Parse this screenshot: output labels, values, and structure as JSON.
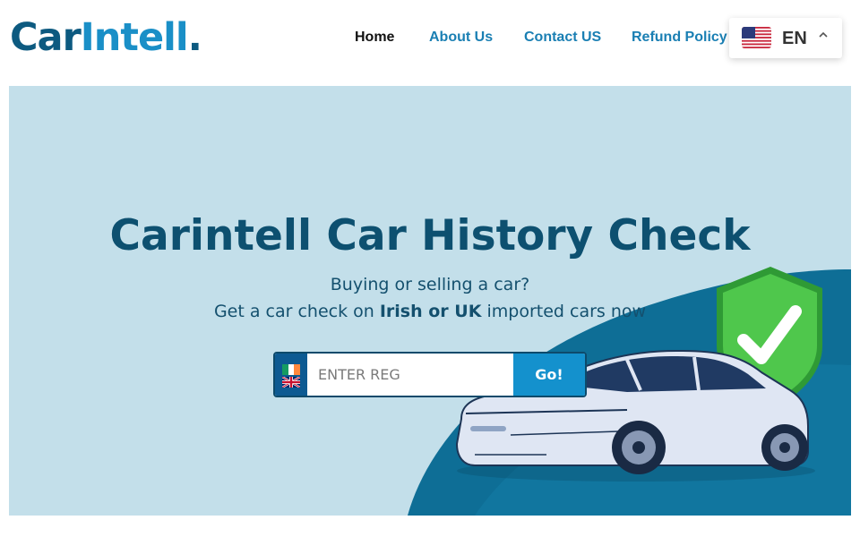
{
  "header": {
    "logo": {
      "part1": "Car",
      "part2": "Intell",
      "part3": "."
    },
    "nav": [
      {
        "label": "Home"
      },
      {
        "label": "About Us"
      },
      {
        "label": "Contact US"
      },
      {
        "label": "Refund Policy"
      }
    ],
    "language": {
      "code": "EN",
      "flag_icon": "us-flag-icon"
    }
  },
  "hero": {
    "title": "Carintell Car History Check",
    "subtitle_line1": "Buying or selling a car?",
    "subtitle_line2_pre": "Get a car check on ",
    "subtitle_line2_bold": "Irish or UK",
    "subtitle_line2_post": " imported cars now",
    "search": {
      "placeholder": "ENTER REG",
      "value": "",
      "button_label": "Go!",
      "flag_icons": [
        "ireland-flag-icon",
        "uk-flag-icon"
      ]
    }
  },
  "colors": {
    "brand_dark": "#0d5a80",
    "brand_light": "#1a8fc7",
    "hero_bg": "#c3dfea",
    "go_button": "#1491cd",
    "shield_green": "#49c04a"
  }
}
